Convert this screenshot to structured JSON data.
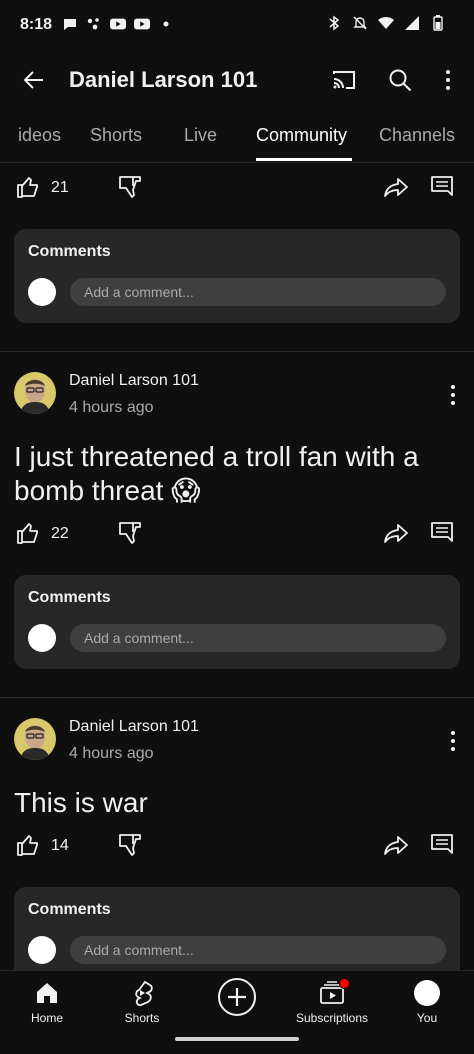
{
  "status_bar": {
    "time": "8:18"
  },
  "app_bar": {
    "title": "Daniel Larson 101"
  },
  "tabs": [
    {
      "label": "ideos",
      "active": false
    },
    {
      "label": "Shorts",
      "active": false
    },
    {
      "label": "Live",
      "active": false
    },
    {
      "label": "Community",
      "active": true
    },
    {
      "label": "Channels",
      "active": false
    }
  ],
  "top_post": {
    "likes": "21",
    "comments_title": "Comments",
    "comment_placeholder": "Add a comment..."
  },
  "posts": [
    {
      "author": "Daniel Larson 101",
      "time": "4 hours ago",
      "text": "I just threatened a troll fan with a bomb threat 😱",
      "likes": "22",
      "comments_title": "Comments",
      "comment_placeholder": "Add a comment..."
    },
    {
      "author": "Daniel Larson 101",
      "time": "4 hours ago",
      "text": "This is war",
      "likes": "14",
      "comments_title": "Comments",
      "comment_placeholder": "Add a comment..."
    }
  ],
  "bottom_nav": {
    "home": "Home",
    "shorts": "Shorts",
    "subscriptions": "Subscriptions",
    "you": "You"
  },
  "colors": {
    "background": "#0f0f0f",
    "card": "#272727",
    "input": "#3f3f3f",
    "notification_dot": "#ff0000"
  }
}
